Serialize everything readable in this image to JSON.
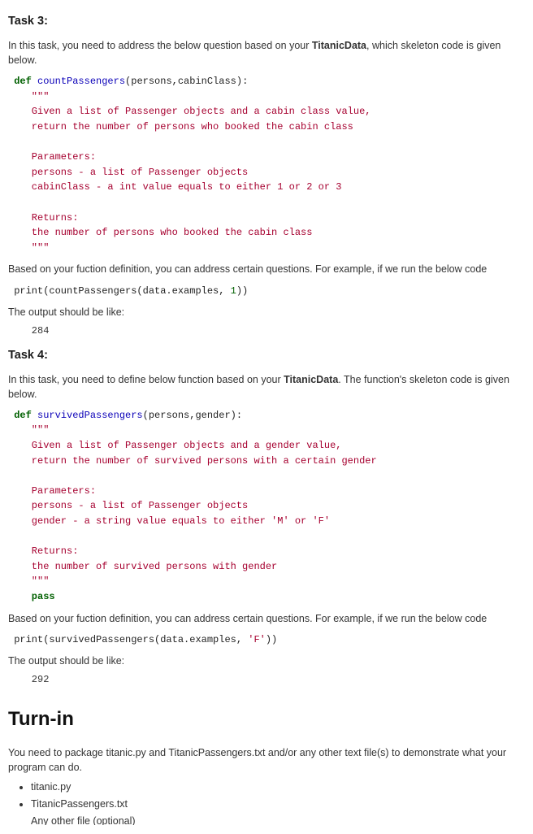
{
  "task3": {
    "heading": "Task 3:",
    "intro_pre": "In this task, you need to address the below question based on your ",
    "intro_bold": "TitanicData",
    "intro_post": ", which skeleton code is given below.",
    "code": {
      "kw_def": "def",
      "fn_name": "countPassengers",
      "params": "(persons,cabinClass):",
      "doc1": "    \"\"\"",
      "doc2": "    Given a list of Passenger objects and a cabin class value,",
      "doc3": "    return the number of persons who booked the cabin class",
      "doc4": "",
      "doc5": "    Parameters:",
      "doc6": "    persons - a list of Passenger objects",
      "doc7": "    cabinClass - a int value equals to either 1 or 2 or 3",
      "doc8": "",
      "doc9": "    Returns:",
      "doc10": "    the number of persons who booked the cabin class",
      "doc11": "    \"\"\""
    },
    "based": "Based on your fuction definition, you can address certain questions. For example, if we run the below code",
    "call": {
      "prefix": " print(countPassengers(data.examples, ",
      "arg": "1",
      "suffix": "))"
    },
    "outlabel": "The output should be like:",
    "output": "    284"
  },
  "task4": {
    "heading": "Task 4:",
    "intro_pre": "In this task, you need to define below function based on your ",
    "intro_bold": "TitanicData",
    "intro_post": ". The function's skeleton code is given below.",
    "code": {
      "kw_def": "def",
      "fn_name": "survivedPassengers",
      "params": "(persons,gender):",
      "doc1": "    \"\"\"",
      "doc2": "    Given a list of Passenger objects and a gender value,",
      "doc3": "    return the number of survived persons with a certain gender",
      "doc4": "",
      "doc5": "    Parameters:",
      "doc6": "    persons - a list of Passenger objects",
      "doc7": "    gender - a string value equals to either 'M' or 'F'",
      "doc8": "",
      "doc9": "    Returns:",
      "doc10": "    the number of survived persons with gender",
      "doc11": "    \"\"\"",
      "pass": "    pass"
    },
    "based": "Based on your fuction definition, you can address certain questions. For example, if we run the below code",
    "call": {
      "prefix": " print(survivedPassengers(data.examples, ",
      "arg": "'F'",
      "suffix": "))"
    },
    "outlabel": "The output should be like:",
    "output": "    292"
  },
  "turnin": {
    "heading": "Turn-in",
    "body": "You need to package titanic.py and TitanicPassengers.txt and/or any other text file(s) to demonstrate what your program can do.",
    "files": {
      "a": "titanic.py",
      "b": "TitanicPassengers.txt",
      "c": "Any other file (optional)"
    }
  }
}
